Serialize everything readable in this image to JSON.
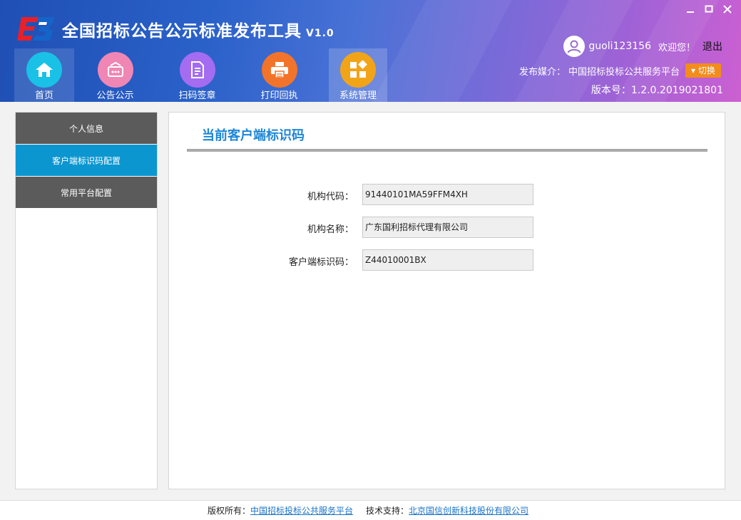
{
  "header": {
    "title": "全国招标公告公示标准发布工具",
    "version_tag": "V1.0",
    "username": "guoli123156",
    "welcome": "欢迎您！",
    "logout": "退出",
    "media_label": "发布媒介：",
    "media_value": "中国招标投标公共服务平台",
    "switch_label": "▾ 切换",
    "build_version": "版本号：1.2.0.2019021801"
  },
  "window_controls": {
    "minimize": "−",
    "maximize": "□",
    "close": "✕"
  },
  "nav": [
    {
      "label": "首页",
      "icon": "home-icon",
      "color": "#19c1e6"
    },
    {
      "label": "公告公示",
      "icon": "announcement-icon",
      "color": "#ef86b4"
    },
    {
      "label": "扫码签章",
      "icon": "document-icon",
      "color": "#a46cf0"
    },
    {
      "label": "打印回执",
      "icon": "printer-icon",
      "color": "#f2742a"
    },
    {
      "label": "系统管理",
      "icon": "settings-grid-icon",
      "color": "#f2a418"
    }
  ],
  "sidebar": {
    "items": [
      {
        "label": "个人信息",
        "active": false
      },
      {
        "label": "客户端标识码配置",
        "active": true
      },
      {
        "label": "常用平台配置",
        "active": false
      }
    ]
  },
  "main": {
    "title": "当前客户端标识码",
    "fields": [
      {
        "label": "机构代码：",
        "value": "91440101MA59FFM4XH"
      },
      {
        "label": "机构名称：",
        "value": "广东国利招标代理有限公司"
      },
      {
        "label": "客户端标识码：",
        "value": "Z44010001BX"
      }
    ]
  },
  "footer": {
    "copyright_label": "版权所有：",
    "copyright_link": "中国招标投标公共服务平台",
    "support_label": "技术支持：",
    "support_link": "北京国信创新科技股份有限公司"
  }
}
